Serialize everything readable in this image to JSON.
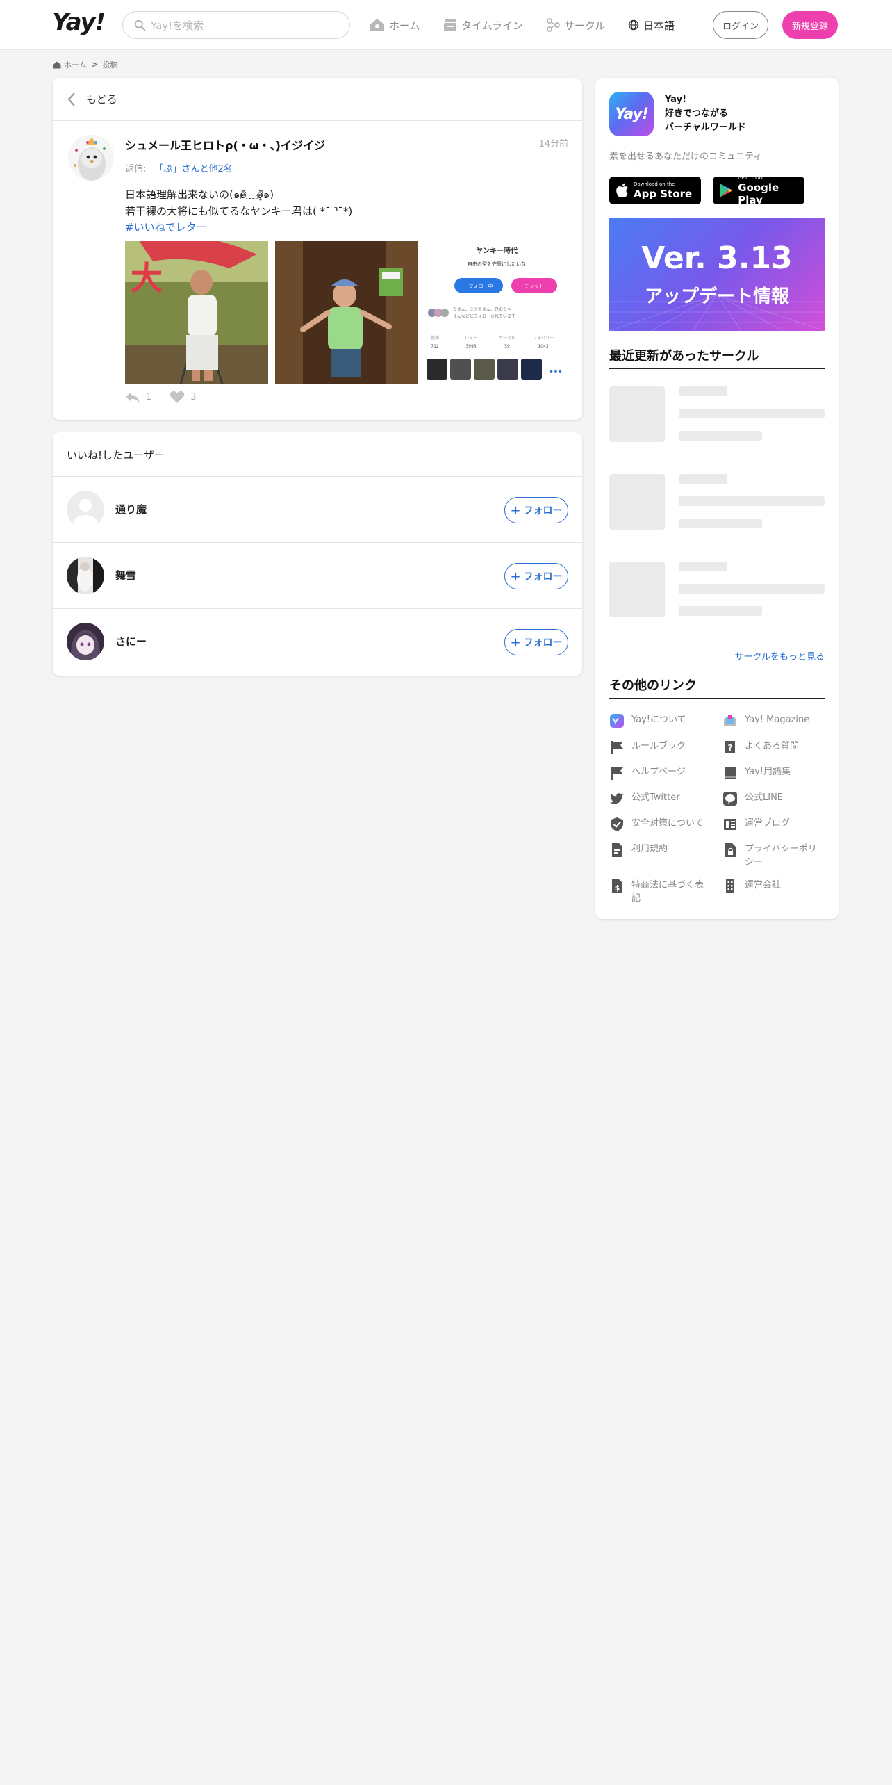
{
  "header": {
    "logo": "Yay!",
    "search_placeholder": "Yay!を検索",
    "nav": {
      "home": "ホーム",
      "timeline": "タイムライン",
      "circle": "サークル",
      "language": "日本語"
    },
    "login": "ログイン",
    "signup": "新規登録"
  },
  "breadcrumb": {
    "home": "ホーム",
    "separator": ">",
    "current": "投稿"
  },
  "post": {
    "back_label": "もどる",
    "author": "シュメール王ヒロトρ(・ω・、)イジイジ",
    "time": "14分前",
    "reply_prefix": "返信:",
    "reply_to": "「ぷ」さんと他2名",
    "text_line1": "日本語理解出来ないの(๑o̴̶̷᷄﹏o̴̶̷̥᷅๑)",
    "text_line2": "若干裸の大将にも似てるなヤンキー君は( *¯ ³¯*)",
    "hashtag": "#いいねでレター",
    "reply_count": "1",
    "like_count": "3",
    "screenshot_card": {
      "name": "ヤンキー時代",
      "bio": "自由の型を完璧にしたいな",
      "follow_btn": "フォロー中",
      "chat_btn": "チャット",
      "followers_note_1": "ちさん、ミツ矢さん、ひおちゃ",
      "followers_note_2": "さんなどにフォローされています",
      "stats": [
        {
          "label": "投稿",
          "value": "712"
        },
        {
          "label": "レター",
          "value": "3995"
        },
        {
          "label": "サークル",
          "value": "59"
        },
        {
          "label": "フォロワー",
          "value": "1043"
        }
      ],
      "more": "•••"
    },
    "photo1_caption": "大"
  },
  "likes": {
    "title": "いいね!したユーザー",
    "follow_label": "フォロー",
    "users": [
      {
        "name": "通り魔"
      },
      {
        "name": "舞雪"
      },
      {
        "name": "さにー"
      }
    ]
  },
  "sidebar": {
    "app_icon_text": "Yay!",
    "app_name": "Yay!",
    "tagline_1": "好きでつながる",
    "tagline_2": "バーチャルワールド",
    "community": "素を出せるあなただけのコミュニティ",
    "appstore_small": "Download on the",
    "appstore_big": "App Store",
    "googleplay_small": "GET IT ON",
    "googleplay_big": "Google Play",
    "banner_version": "Ver. 3.13",
    "banner_update": "アップデート情報",
    "recent_circles_title": "最近更新があったサークル",
    "more_circles": "サークルをもっと見る",
    "other_links_title": "その他のリンク",
    "links": [
      {
        "label": "Yay!について",
        "icon": "yay-app-icon"
      },
      {
        "label": "Yay! Magazine",
        "icon": "magazine-icon"
      },
      {
        "label": "ルールブック",
        "icon": "flag-icon"
      },
      {
        "label": "よくある質問",
        "icon": "question-icon"
      },
      {
        "label": "ヘルプページ",
        "icon": "flag-icon"
      },
      {
        "label": "Yay!用語集",
        "icon": "book-icon"
      },
      {
        "label": "公式Twitter",
        "icon": "twitter-icon"
      },
      {
        "label": "公式LINE",
        "icon": "line-icon"
      },
      {
        "label": "安全対策について",
        "icon": "shield-icon"
      },
      {
        "label": "運営ブログ",
        "icon": "blog-icon"
      },
      {
        "label": "利用規約",
        "icon": "document-icon"
      },
      {
        "label": "プライバシーポリシー",
        "icon": "lock-icon"
      },
      {
        "label": "特商法に基づく表記",
        "icon": "dollar-document-icon"
      },
      {
        "label": "運営会社",
        "icon": "building-icon"
      }
    ]
  },
  "colors": {
    "accent_pink": "#ee3fae",
    "link_blue": "#2a6fd0",
    "background": "#f4f4f4"
  }
}
